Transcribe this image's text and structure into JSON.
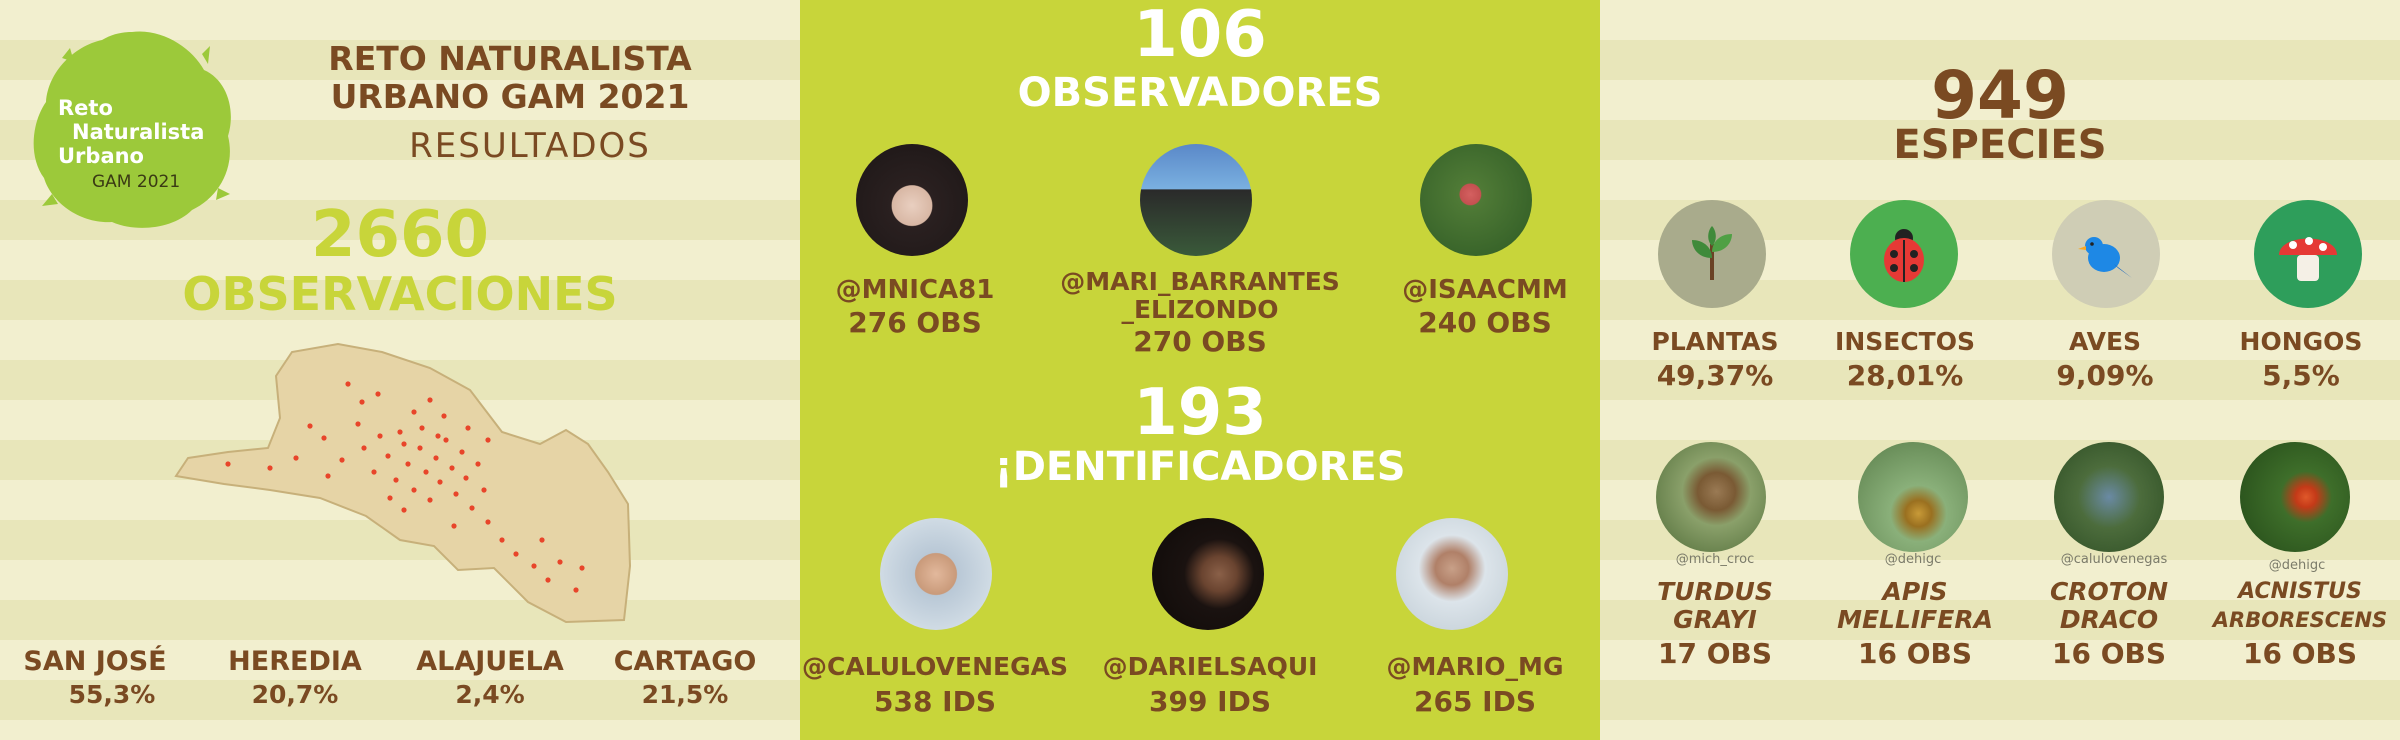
{
  "logo": {
    "line1": "Reto",
    "line2": "Naturalista",
    "line3": "Urbano",
    "line4": "GAM 2021",
    "bg": "#9cc93a"
  },
  "header": {
    "title1": "RETO NATURALISTA",
    "title2": "URBANO GAM 2021",
    "subtitle": "RESULTADOS"
  },
  "observations": {
    "count": "2660",
    "label": "OBSERVACIONES"
  },
  "map": {
    "description_icon": "map-of-gam-with-observation-points"
  },
  "regions": [
    {
      "name": "SAN JOSÉ",
      "pct": "55,3%"
    },
    {
      "name": "HEREDIA",
      "pct": "20,7%"
    },
    {
      "name": "ALAJUELA",
      "pct": "2,4%"
    },
    {
      "name": "CARTAGO",
      "pct": "21,5%"
    }
  ],
  "observers": {
    "count": "106",
    "label": "OBSERVADORES",
    "people": [
      {
        "user": "@MNICA81",
        "user2": "",
        "obs": "276 OBS"
      },
      {
        "user": "@MARI_BARRANTES",
        "user2": "_ELIZONDO",
        "obs": "270 OBS"
      },
      {
        "user": "@ISAACMM",
        "user2": "",
        "obs": "240 OBS"
      }
    ]
  },
  "identifiers": {
    "count": "193",
    "label": "¡DENTIFICADORES",
    "people": [
      {
        "user": "@CALULOVENEGAS",
        "ids": "538 IDS"
      },
      {
        "user": "@DARIELSAQUI",
        "ids": "399 IDS"
      },
      {
        "user": "@MARIO_MG",
        "ids": "265 IDS"
      }
    ]
  },
  "species": {
    "count": "949",
    "label": "ESPECIES",
    "groups": [
      {
        "name": "PLANTAS",
        "pct": "49,37%",
        "icon": "plant-icon",
        "color": "#a9ab8c"
      },
      {
        "name": "INSECTOS",
        "pct": "28,01%",
        "icon": "ladybug-icon",
        "color": "#4caf50"
      },
      {
        "name": "AVES",
        "pct": "9,09%",
        "icon": "bird-icon",
        "color": "#cfcdb5"
      },
      {
        "name": "HONGOS",
        "pct": "5,5%",
        "icon": "mushroom-icon",
        "color": "#2e9e5b"
      }
    ],
    "top": [
      {
        "credit": "@mich_croc",
        "name1": "TURDUS",
        "name2": "GRAYI",
        "obs": "17 OBS"
      },
      {
        "credit": "@dehigc",
        "name1": "APIS",
        "name2": "MELLIFERA",
        "obs": "16 OBS"
      },
      {
        "credit": "@calulovenegas",
        "name1": "CROTON",
        "name2": "DRACO",
        "obs": "16 OBS"
      },
      {
        "credit": "@dehigc",
        "name1": "ACNISTUS",
        "name2": "ARBORESCENS",
        "obs": "16 OBS"
      }
    ]
  },
  "colors": {
    "brown": "#7a4a22",
    "lime": "#c8d53a",
    "cream": "#f2efcf"
  }
}
